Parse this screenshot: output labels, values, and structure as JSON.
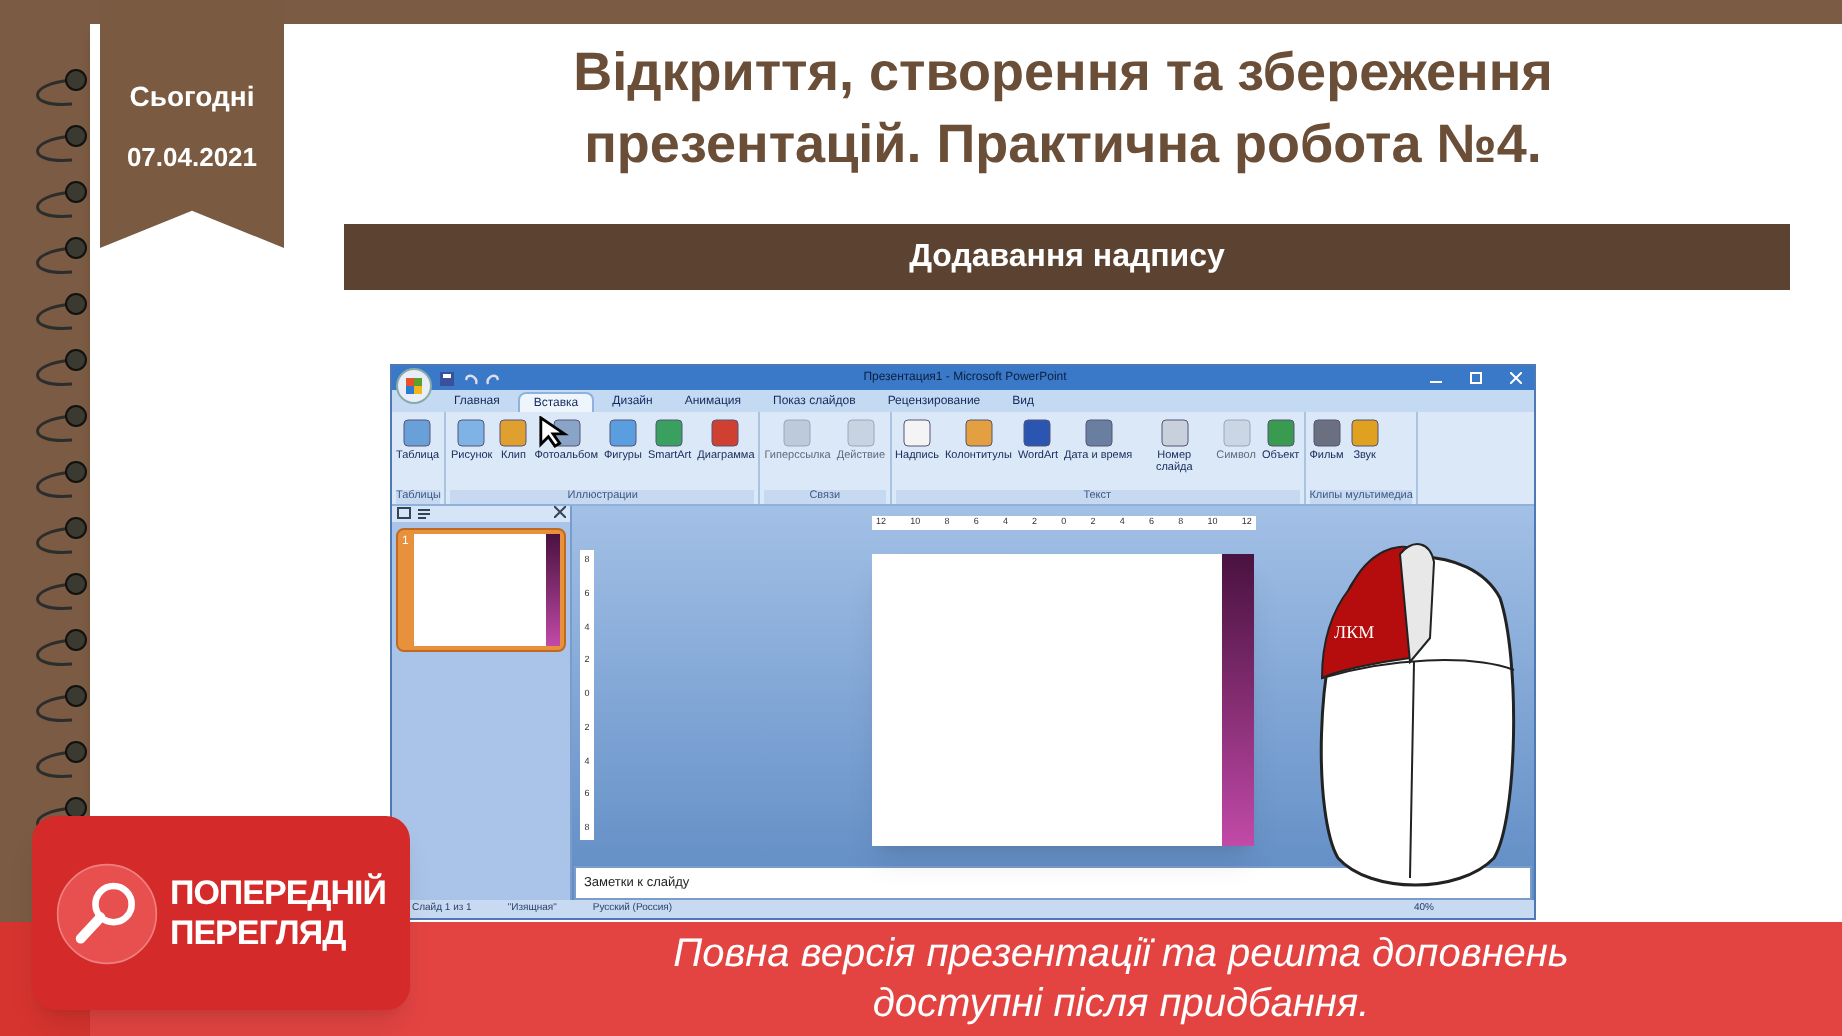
{
  "date_ribbon": {
    "label": "Сьогодні",
    "date": "07.04.2021"
  },
  "title": "Відкриття, створення та збереження презентацій. Практична робота №4.",
  "section_header": "Додавання надпису",
  "screenshot": {
    "window_title": "Презентация1 - Microsoft PowerPoint",
    "tabs": [
      {
        "label": "Главная",
        "selected": false
      },
      {
        "label": "Вставка",
        "selected": true
      },
      {
        "label": "Дизайн",
        "selected": false
      },
      {
        "label": "Анимация",
        "selected": false
      },
      {
        "label": "Показ слайдов",
        "selected": false
      },
      {
        "label": "Рецензирование",
        "selected": false
      },
      {
        "label": "Вид",
        "selected": false
      }
    ],
    "groups": [
      {
        "label": "Таблицы",
        "buttons": [
          {
            "label": "Таблица",
            "disabled": false
          }
        ]
      },
      {
        "label": "Иллюстрации",
        "buttons": [
          {
            "label": "Рисунок",
            "disabled": false
          },
          {
            "label": "Клип",
            "disabled": false
          },
          {
            "label": "Фотоальбом",
            "disabled": false
          },
          {
            "label": "Фигуры",
            "disabled": false
          },
          {
            "label": "SmartArt",
            "disabled": false
          },
          {
            "label": "Диаграмма",
            "disabled": false
          }
        ]
      },
      {
        "label": "Связи",
        "buttons": [
          {
            "label": "Гиперссылка",
            "disabled": true
          },
          {
            "label": "Действие",
            "disabled": true
          }
        ]
      },
      {
        "label": "Текст",
        "buttons": [
          {
            "label": "Надпись",
            "disabled": false
          },
          {
            "label": "Колонтитулы",
            "disabled": false
          },
          {
            "label": "WordArt",
            "disabled": false
          },
          {
            "label": "Дата и время",
            "disabled": false
          },
          {
            "label": "Номер слайда",
            "disabled": false
          },
          {
            "label": "Символ",
            "disabled": true
          },
          {
            "label": "Объект",
            "disabled": false
          }
        ]
      },
      {
        "label": "Клипы мультимедиа",
        "buttons": [
          {
            "label": "Фильм",
            "disabled": false
          },
          {
            "label": "Звук",
            "disabled": false
          }
        ]
      }
    ],
    "slides": [
      {
        "number": "1",
        "selected": true
      }
    ],
    "ruler_horizontal": [
      "12",
      "10",
      "8",
      "6",
      "4",
      "2",
      "0",
      "2",
      "4",
      "6",
      "8",
      "10",
      "12"
    ],
    "ruler_vertical": [
      "8",
      "6",
      "4",
      "2",
      "0",
      "2",
      "4",
      "6",
      "8"
    ],
    "notes_placeholder": "Заметки к слайду",
    "status_bar": [
      "Слайд 1 из 1",
      "\"Изящная\"",
      "Русский (Россия)",
      "40%"
    ],
    "mouse": {
      "label": "ЛКМ"
    }
  },
  "preview_badge": {
    "lines": [
      "ПОПЕРЕДНІЙ",
      "ПЕРЕГЛЯД"
    ]
  },
  "preview_notice": "Повна версія презентації та решта доповнень доступні після придбання."
}
